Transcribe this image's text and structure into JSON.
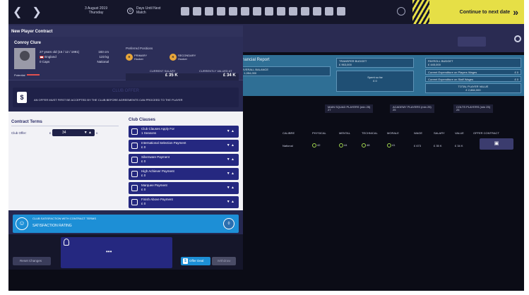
{
  "topbar": {
    "date_line1": "3 August 2019",
    "date_line2": "Thursday",
    "days_count": "0",
    "days_line1": "Days Until Next",
    "days_line2": "Match",
    "continue_label": "Continue to next date"
  },
  "finance": {
    "title": "Financial Report",
    "overall_balance_label": "OVERALL BALANCE",
    "overall_balance_value": "£ 1,054,000",
    "transfer_budget_label": "TRANSFER BUDGET",
    "transfer_budget_value": "£ 963,000",
    "spent_so_far_label": "Spent so far",
    "spent_so_far_value": "£ 0",
    "payroll_budget_label": "PAYROLL BUDGET",
    "payroll_budget_value": "£ 445,000",
    "exp_players_label": "Current Expenditure on Players Wages",
    "exp_players_value": "£ 0",
    "exp_staff_label": "Current Expenditure on Staff Wages",
    "exp_staff_value": "£ 0",
    "total_player_value_label": "TOTAL PLAYER VALUE",
    "total_player_value": "£ 2,884,000"
  },
  "squads": {
    "main": "MAIN SQUAD PLAYERS (min 25)",
    "main_val": "27",
    "academy": "ACADEMY PLAYERS (min 25)",
    "academy_val": "25",
    "colts": "COLTS PLAYERS (min 25)",
    "colts_val": "25"
  },
  "table": {
    "headers": [
      "CALIBRE",
      "PHYSICAL",
      "MENTAL",
      "TECHNICAL",
      "MORALE",
      "WAGE",
      "SALARY",
      "VALUE",
      "OFFER CONTRACT"
    ],
    "row": {
      "calibre": "National",
      "physical": "42",
      "mental": "44",
      "technical": "48",
      "morale": "41",
      "wage": "£ 673",
      "salary": "£ 35 K",
      "value": "£ 34 K"
    }
  },
  "modal": {
    "title": "New Player Contract",
    "player_name": "Conroy Clure",
    "age_dob": "27 years old (16 / 12 / 1991)",
    "nation": "England",
    "caps": "0 Caps",
    "height": "183 cm",
    "weight": "123 kg",
    "level": "National",
    "potential_label": "Potential",
    "preferred_positions_label": "Preferred Positions",
    "primary_label": "PRIMARY",
    "primary_pos": "Hooker",
    "secondary_label": "SECONDARY",
    "secondary_pos": "Hooker",
    "current_salary_label": "CURRENT SALARY",
    "current_salary": "£ 35 K",
    "valued_at_label": "CURRENTLY VALUED AT",
    "valued_at": "£ 34 K",
    "club_offer_title": "CLUB OFFER",
    "club_offer_notice": "AN OFFER MUST FIRST BE ACCEPTED BY THE CLUB BEFORE AGREEMENTS CAN PROCEED TO THE PLAYER",
    "contract_terms_title": "Contract Terms",
    "club_offer_label": "Club Offer:",
    "club_offer_value": "34",
    "club_offer_currency": "£",
    "club_offer_unit": "K",
    "club_clauses_title": "Club Clauses",
    "clauses": [
      {
        "label": "Club Clauses Apply For",
        "value": "1  Seasons"
      },
      {
        "label": "International Selection Payment",
        "value": "£  0"
      },
      {
        "label": "Silverware Payment",
        "value": "£  0"
      },
      {
        "label": "High Achiever Payment",
        "value": "£  0"
      },
      {
        "label": "Marquee Payment",
        "value": "£  0"
      },
      {
        "label": "Finish Above Payment",
        "value": "£  0"
      }
    ],
    "satisfaction_label": "CLUB SATISFACTION WITH CONTRACT TERMS",
    "satisfaction_rating_label": "SATISFACTION RATING",
    "satisfaction_value": "0",
    "reset_label": "Reset Changes",
    "offer_deal_label": "Offer Deal",
    "withdraw_label": "Withdraw"
  },
  "colors": {
    "accent_yellow": "#e6df46",
    "panel_blue": "#252880",
    "sat_blue": "#1d8fd6",
    "finance_blue": "#2f6f95"
  }
}
